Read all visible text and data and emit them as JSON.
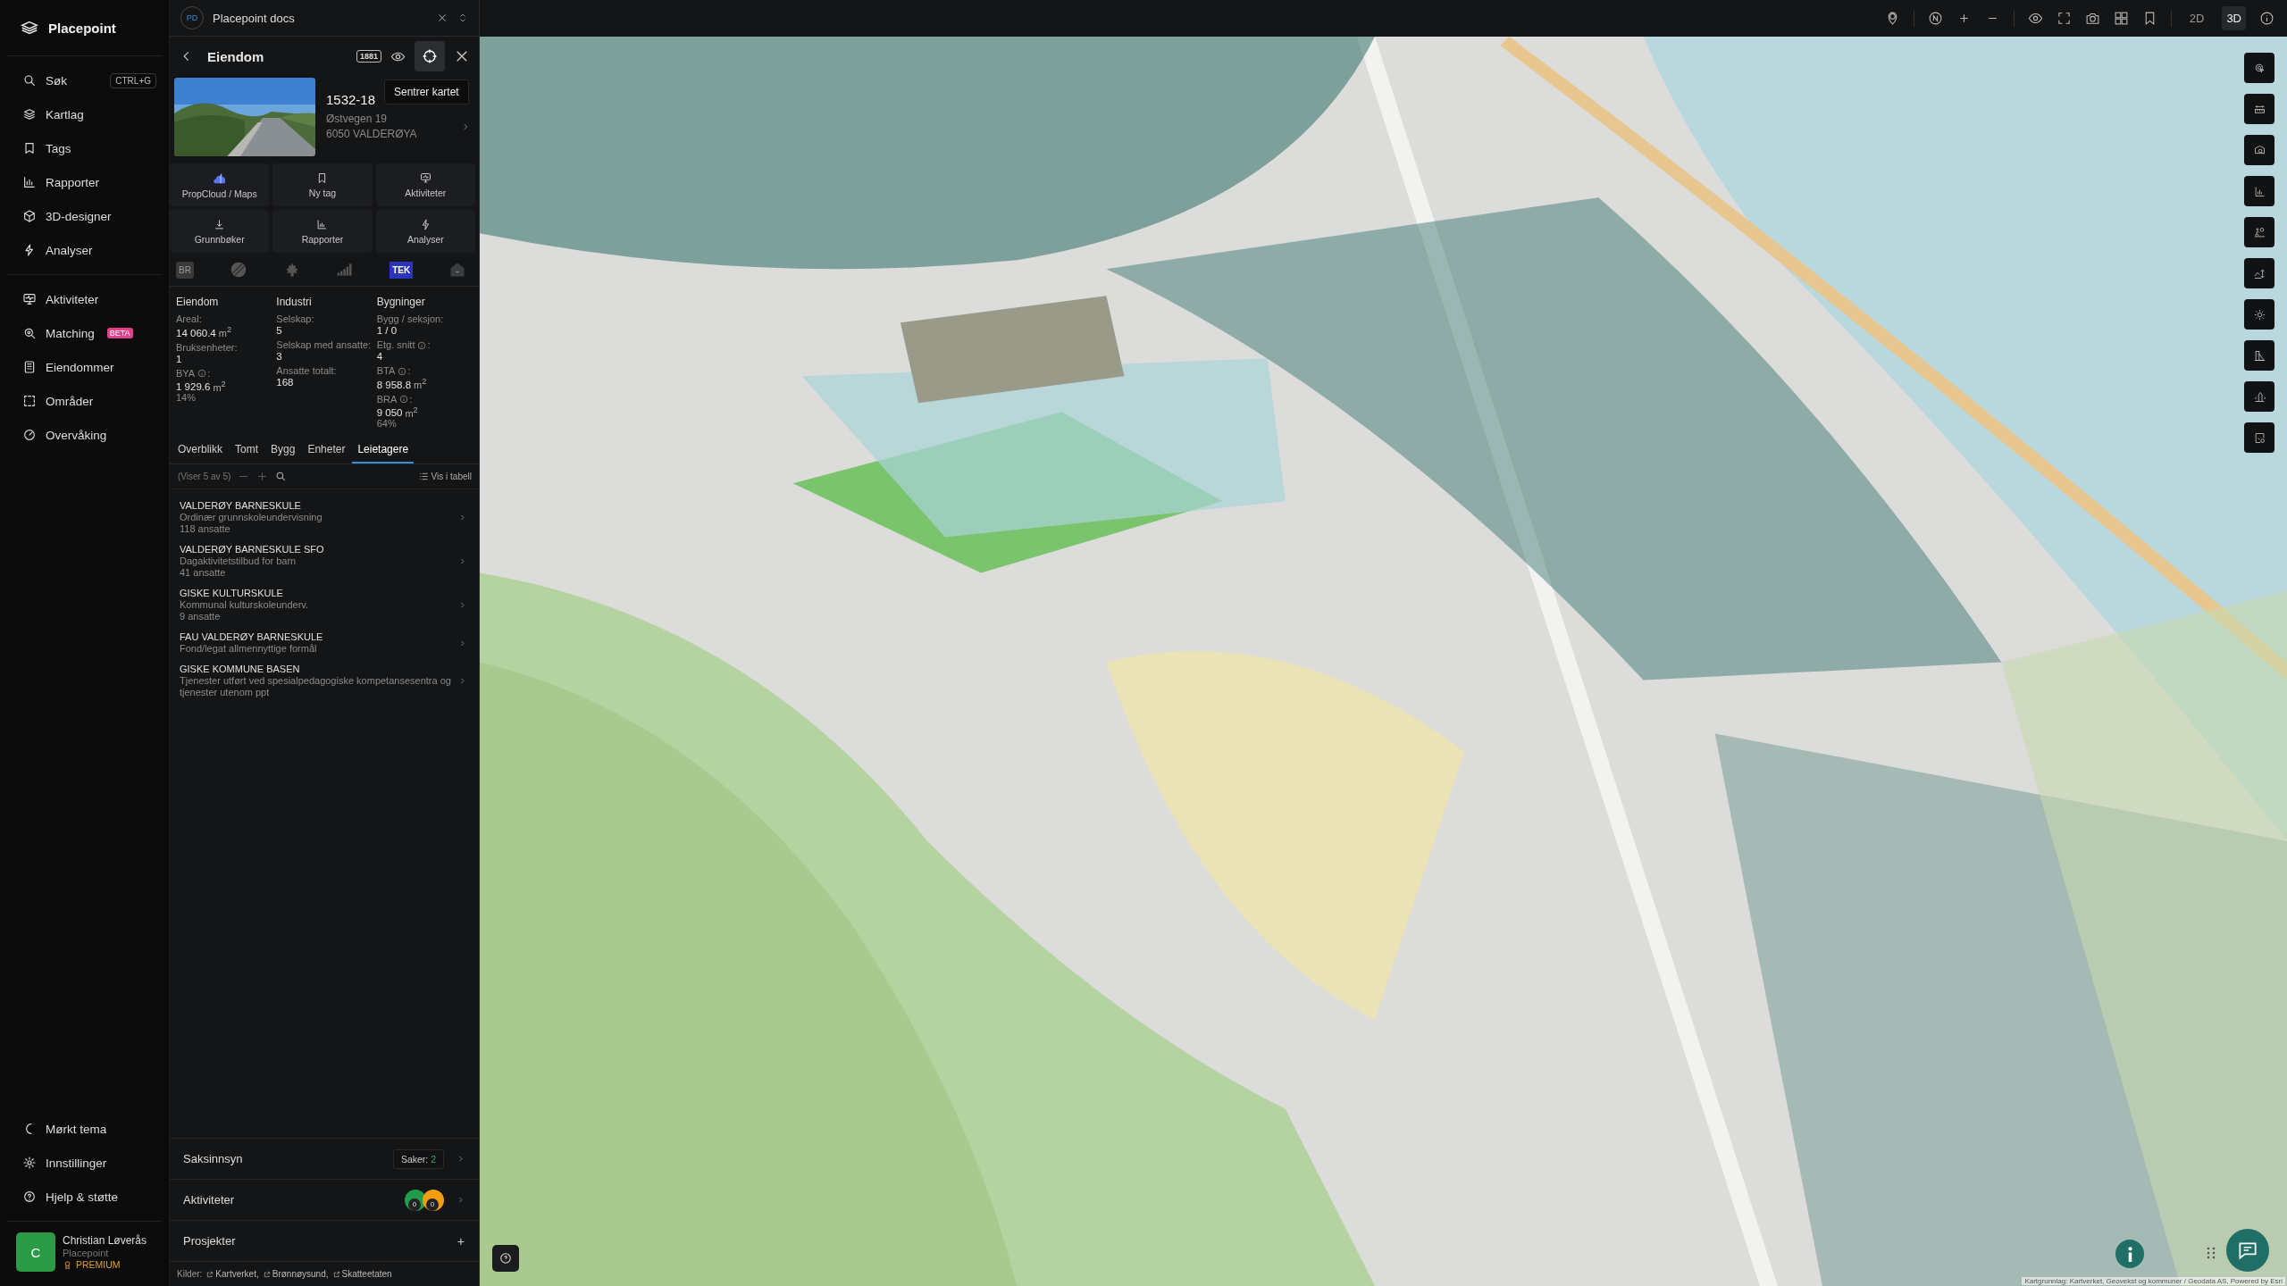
{
  "sidebar": {
    "brand": "Placepoint",
    "nav_main": [
      {
        "label": "Søk",
        "shortcut": "CTRL+G"
      },
      {
        "label": "Kartlag"
      },
      {
        "label": "Tags"
      },
      {
        "label": "Rapporter"
      },
      {
        "label": "3D-designer"
      },
      {
        "label": "Analyser"
      }
    ],
    "nav_secondary": [
      {
        "label": "Aktiviteter"
      },
      {
        "label": "Matching",
        "badge": "BETA"
      },
      {
        "label": "Eiendommer"
      },
      {
        "label": "Områder"
      },
      {
        "label": "Overvåking"
      }
    ],
    "footer_items": [
      {
        "label": "Mørkt tema"
      },
      {
        "label": "Innstillinger"
      },
      {
        "label": "Hjelp & støtte"
      }
    ],
    "user": {
      "initial": "C",
      "name": "Christian Løverås",
      "org": "Placepoint",
      "plan": "PREMIUM"
    }
  },
  "panel": {
    "doc": {
      "badge": "PD",
      "title": "Placepoint docs"
    },
    "header": {
      "title": "Eiendom",
      "badge": "1881",
      "tooltip": "Sentrer kartet"
    },
    "property": {
      "id": "1532-18",
      "address": "Østvegen 19",
      "postal": "6050 VALDERØYA"
    },
    "actions": [
      {
        "label": "PropCloud / Maps"
      },
      {
        "label": "Ny tag"
      },
      {
        "label": "Aktiviteter"
      },
      {
        "label": "Grunnbøker"
      },
      {
        "label": "Rapporter"
      },
      {
        "label": "Analyser"
      }
    ],
    "sources": [
      {
        "kind": "text",
        "label": "BR"
      },
      {
        "kind": "icon"
      },
      {
        "kind": "icon"
      },
      {
        "kind": "icon"
      },
      {
        "kind": "tek",
        "label": "TEK"
      },
      {
        "kind": "icon"
      }
    ],
    "stats": [
      {
        "heading": "Eiendom",
        "fields": [
          {
            "label": "Areal",
            "suffix": ":",
            "value": "14 060.4",
            "unit": "m$^{2}$"
          },
          {
            "label": "Bruksenheter",
            "suffix": ":",
            "value": "1"
          },
          {
            "label": "BYA",
            "info": true,
            "suffix": ":",
            "value": "1 929.6",
            "unit": "m$^{2}$",
            "share": "14%"
          }
        ]
      },
      {
        "heading": "Industri",
        "fields": [
          {
            "label": "Selskap",
            "suffix": ":",
            "value": "5"
          },
          {
            "label": "Selskap med ansatte",
            "suffix": ":",
            "value": "3"
          },
          {
            "label": "Ansatte totalt",
            "suffix": ":",
            "value": "168"
          }
        ]
      },
      {
        "heading": "Bygninger",
        "fields": [
          {
            "label": "Bygg / seksjon",
            "suffix": ":",
            "value": "1 / 0"
          },
          {
            "label": "Etg. snitt",
            "info": true,
            "suffix": ":",
            "value": "4"
          },
          {
            "label": "BTA",
            "info": true,
            "suffix": ":",
            "value": "8 958.8",
            "unit": "m$^{2}$"
          },
          {
            "label": "BRA",
            "info": true,
            "suffix": ":",
            "value": "9 050",
            "unit": "m$^{2}$",
            "share": "64%"
          }
        ]
      }
    ],
    "tabs": [
      {
        "label": "Overblikk",
        "selected": false
      },
      {
        "label": "Tomt",
        "selected": false
      },
      {
        "label": "Bygg",
        "selected": false
      },
      {
        "label": "Enheter",
        "selected": false
      },
      {
        "label": "Leietagere",
        "selected": true
      }
    ],
    "list_toolbar": {
      "count": "(Viser 5 av 5)",
      "table_link": "Vis i tabell"
    },
    "tenants": [
      {
        "name": "VALDERØY BARNESKULE",
        "description": "Ordinær grunnskoleundervisning",
        "employees": "118 ansatte"
      },
      {
        "name": "VALDERØY BARNESKULE SFO",
        "description": "Dagaktivitetstilbud for barn",
        "employees": "41 ansatte"
      },
      {
        "name": "GISKE KULTURSKULE",
        "description": "Kommunal kulturskoleunderv.",
        "employees": "9 ansatte"
      },
      {
        "name": "FAU VALDERØY BARNESKULE",
        "description": "Fond/legat allmennyttige formål"
      },
      {
        "name": "GISKE KOMMUNE BASEN",
        "description": "Tjenester utført ved spesialpedagogiske kompetansesentra og tjenester utenom ppt"
      }
    ],
    "sections": [
      {
        "kind": "cases",
        "label": "Saksinnsyn",
        "key": "Saker:",
        "count": "2"
      },
      {
        "kind": "activities",
        "label": "Aktiviteter",
        "badges": [
          {
            "count": "0",
            "color": "#1f9d48"
          },
          {
            "count": "0",
            "color": "#f39c12"
          }
        ]
      },
      {
        "kind": "add",
        "label": "Prosjekter",
        "action": "+"
      }
    ],
    "sources_footer": {
      "label": "Kilder:",
      "links": [
        "Kartverket,",
        "Brønnøysund,",
        "Skatteetaten"
      ]
    }
  },
  "map": {
    "view_modes": [
      {
        "label": "2D",
        "selected": false
      },
      {
        "label": "3D",
        "selected": true
      }
    ],
    "attribution": "Kartgrunnlag: Kartverket, Geovekst og kommuner / Geodata AS, Powered by Esri"
  }
}
